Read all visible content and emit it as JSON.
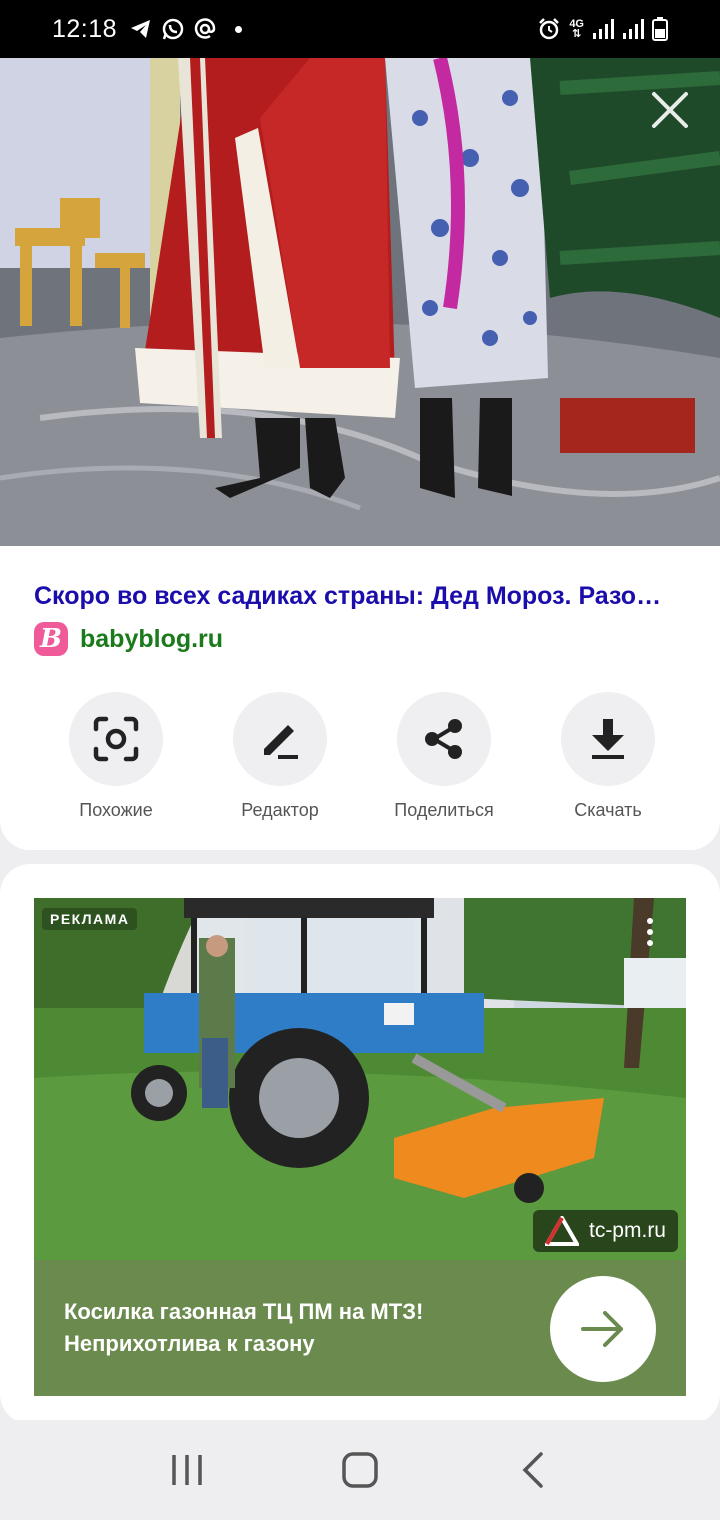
{
  "status_bar": {
    "time": "12:18",
    "left_icons": [
      "telegram-icon",
      "whatsapp-icon",
      "at-sign-icon"
    ],
    "network_label_top": "4G",
    "right_icons": [
      "alarm-icon",
      "signal-icon",
      "signal-icon",
      "battery-icon"
    ]
  },
  "result": {
    "title": "Скоро во всех садиках страны: Дед Мороз. Разо…",
    "source_logo_letter": "B",
    "source_domain": "babyblog.ru"
  },
  "actions": [
    {
      "label": "Похожие",
      "icon": "similar-search-icon"
    },
    {
      "label": "Редактор",
      "icon": "pencil-icon"
    },
    {
      "label": "Поделиться",
      "icon": "share-icon"
    },
    {
      "label": "Скачать",
      "icon": "download-icon"
    }
  ],
  "ad": {
    "label": "РЕКЛАМА",
    "source_domain": "tc-pm.ru",
    "text": "Косилка газонная ТЦ ПМ на МТЗ! Неприхотлива к газону",
    "colors": {
      "bottom_panel": "#6b8a4e"
    }
  },
  "colors": {
    "title_link": "#1a0dab",
    "domain_green": "#1b7a1b",
    "logo_pink": "#ef5a98"
  }
}
